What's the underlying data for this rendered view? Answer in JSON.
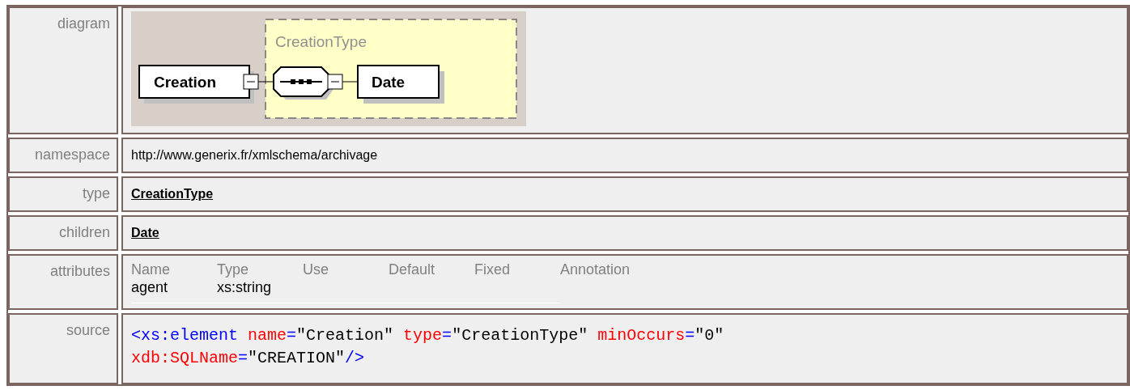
{
  "rows": [
    {
      "kind": "diagram",
      "label": "diagram",
      "diagram": {
        "element": "Creation",
        "type_name": "CreationType",
        "child": "Date"
      }
    },
    {
      "kind": "text",
      "label": "namespace",
      "value": "http://www.generix.fr/xmlschema/archivage"
    },
    {
      "kind": "link",
      "label": "type",
      "value": "CreationType"
    },
    {
      "kind": "link",
      "label": "children",
      "value": "Date"
    },
    {
      "kind": "attributes",
      "label": "attributes",
      "columns": [
        "Name",
        "Type",
        "Use",
        "Default",
        "Fixed",
        "Annotation"
      ],
      "rows": [
        [
          "agent",
          "xs:string",
          "",
          "",
          "",
          ""
        ]
      ]
    },
    {
      "kind": "source",
      "label": "source",
      "lines": [
        [
          {
            "kind": "tag",
            "text": "<xs:element"
          },
          {
            "kind": "attr",
            "text": " name"
          },
          {
            "kind": "punct",
            "text": "="
          },
          {
            "kind": "value",
            "text": "\"Creation\""
          },
          {
            "kind": "attr",
            "text": " type"
          },
          {
            "kind": "punct",
            "text": "="
          },
          {
            "kind": "value",
            "text": "\"CreationType\""
          },
          {
            "kind": "attr",
            "text": " minOccurs"
          },
          {
            "kind": "punct",
            "text": "="
          },
          {
            "kind": "value",
            "text": "\"0\""
          }
        ],
        [
          {
            "kind": "attr",
            "text": "xdb:SQLName"
          },
          {
            "kind": "punct",
            "text": "="
          },
          {
            "kind": "value",
            "text": "\"CREATION\""
          },
          {
            "kind": "tag",
            "text": "/>"
          }
        ]
      ]
    }
  ]
}
